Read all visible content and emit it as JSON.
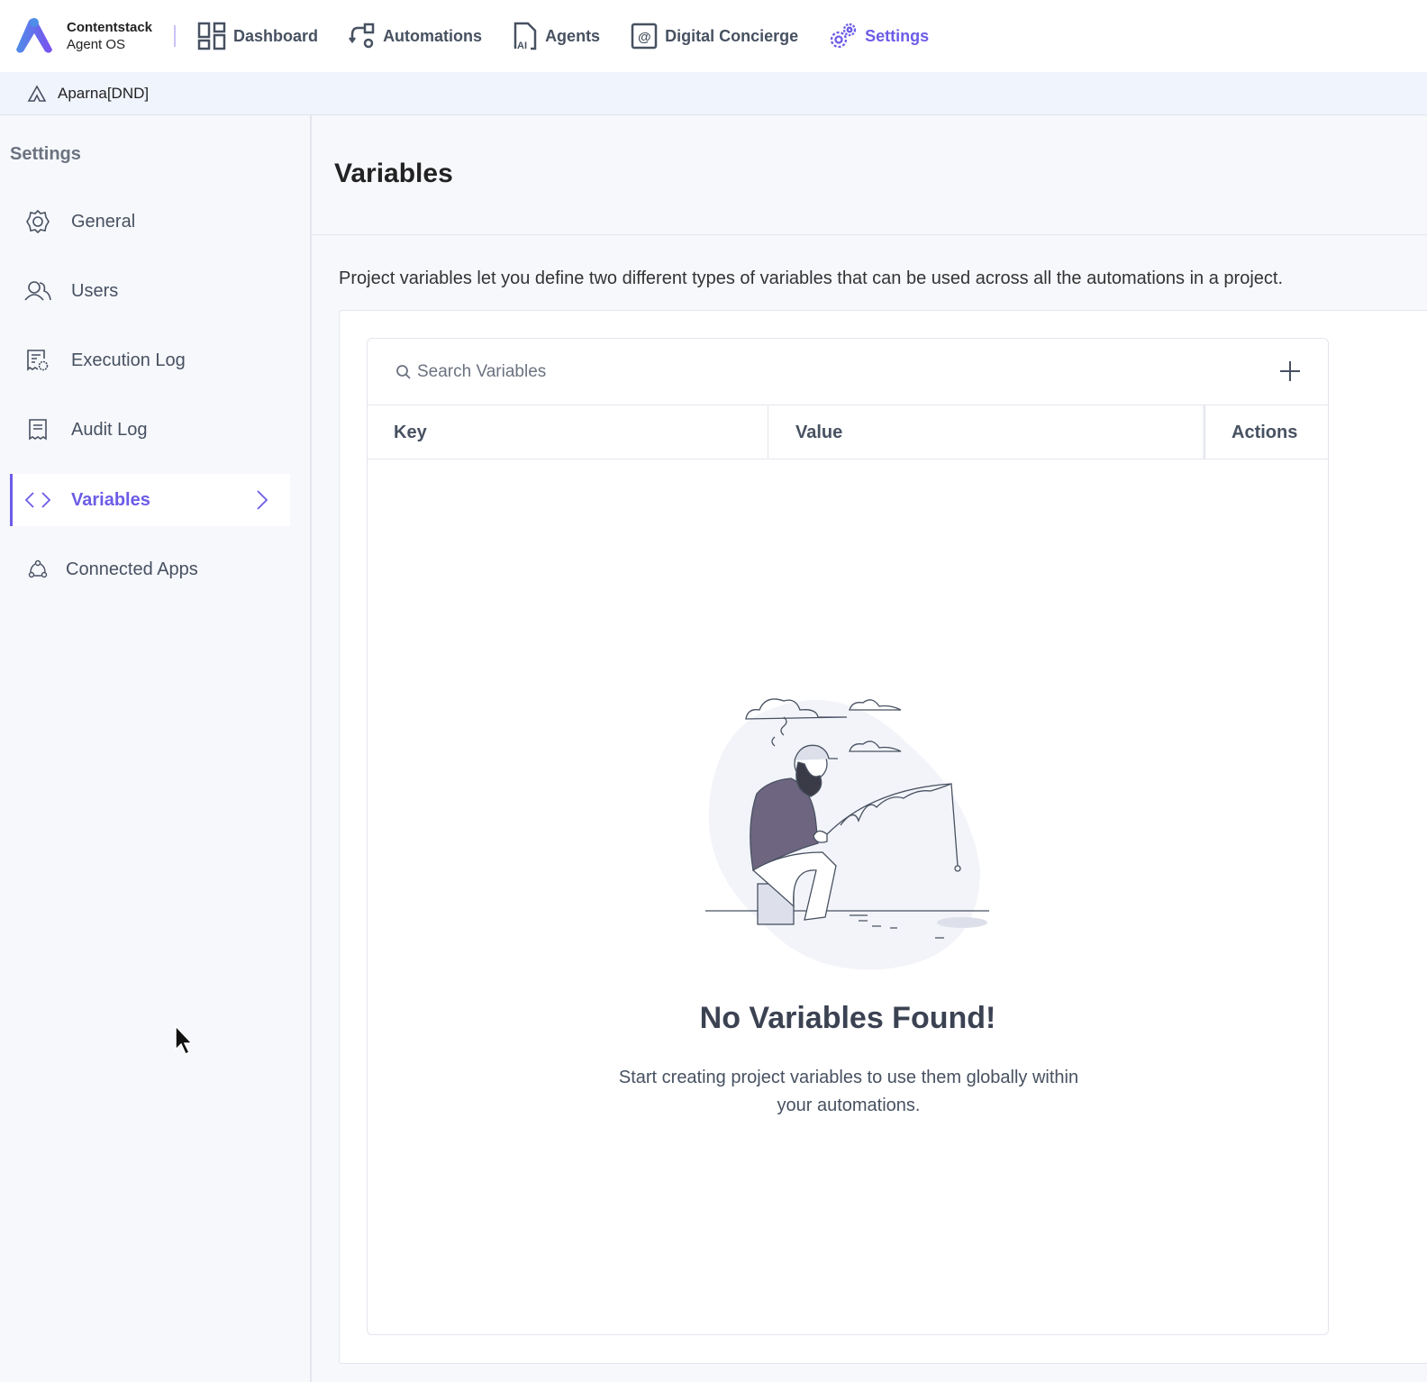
{
  "brand": {
    "name": "Contentstack",
    "product": "Agent OS",
    "accent": "#6c5ce7"
  },
  "nav": [
    {
      "label": "Dashboard",
      "icon": "dashboard-icon"
    },
    {
      "label": "Automations",
      "icon": "automations-icon"
    },
    {
      "label": "Agents",
      "icon": "agents-icon"
    },
    {
      "label": "Digital Concierge",
      "icon": "concierge-icon"
    },
    {
      "label": "Settings",
      "icon": "settings-icon",
      "active": true
    }
  ],
  "breadcrumb": {
    "project": "Aparna[DND]"
  },
  "sidebar": {
    "title": "Settings",
    "items": [
      {
        "label": "General",
        "icon": "gear-icon"
      },
      {
        "label": "Users",
        "icon": "users-icon"
      },
      {
        "label": "Execution Log",
        "icon": "execution-log-icon"
      },
      {
        "label": "Audit Log",
        "icon": "audit-log-icon"
      },
      {
        "label": "Variables",
        "icon": "code-icon",
        "active": true
      },
      {
        "label": "Connected Apps",
        "icon": "connected-apps-icon"
      }
    ]
  },
  "main": {
    "title": "Variables",
    "description": "Project variables let you define two different types of variables that can be used across all the automations in a project.",
    "search_placeholder": "Search Variables",
    "columns": [
      "Key",
      "Value",
      "Actions"
    ],
    "empty_title": "No Variables Found!",
    "empty_subtitle": "Start creating project variables to use them globally within your automations."
  }
}
